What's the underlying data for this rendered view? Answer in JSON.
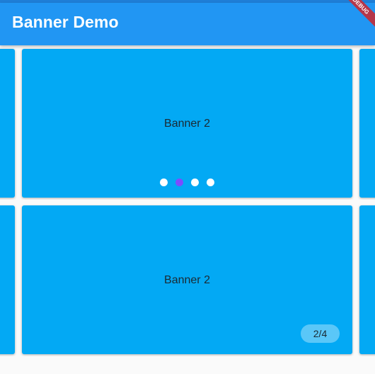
{
  "appbar": {
    "title": "Banner Demo",
    "debug_label": "DEBUG"
  },
  "colors": {
    "appbar": "#2196f3",
    "banner": "#03a9f4",
    "dot_inactive": "#ffffff",
    "dot_active": "#7c4dff"
  },
  "carousel_dots": {
    "current_label": "Banner 2",
    "dot_count": 4,
    "active_index": 1
  },
  "carousel_counter": {
    "current_label": "Banner 2",
    "counter_text": "2/4"
  }
}
